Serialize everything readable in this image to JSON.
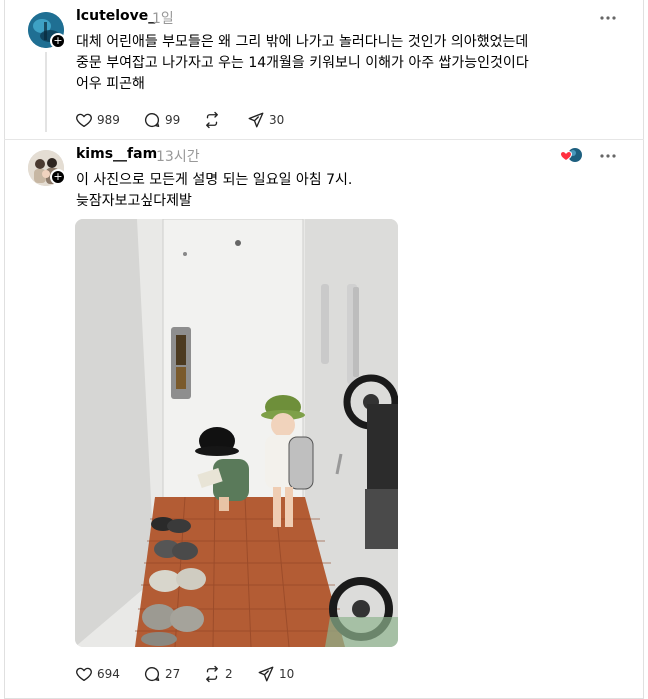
{
  "post1": {
    "username": "lcutelove_",
    "timestamp": "1일",
    "text": "대체 어린애들 부모들은 왜 그리 밖에 나가고 놀러다니는 것인가 의아했었는데\n중문 부여잡고 나가자고 우는 14개월을 키워보니 이해가 아주 쌉가능인것이다\n어우 피곤해",
    "likes": "989",
    "replies": "99",
    "reposts": "",
    "shares": "30",
    "avatar_color": "#1f6f93"
  },
  "post2": {
    "username": "kims__fam",
    "timestamp": "13시간",
    "text": "이 사진으로 모든게 설명 되는 일요일 아침 7시.\n늦잠자보고싶다제발",
    "likes": "694",
    "replies": "27",
    "reposts": "2",
    "shares": "10",
    "liker_heart_color": "#ff3040"
  },
  "icons": {
    "more": "more-dots-icon",
    "like": "heart-icon",
    "reply": "comment-icon",
    "repost": "repost-icon",
    "share": "share-send-icon",
    "plus": "plus-icon"
  },
  "badges": {
    "plus": "+"
  }
}
